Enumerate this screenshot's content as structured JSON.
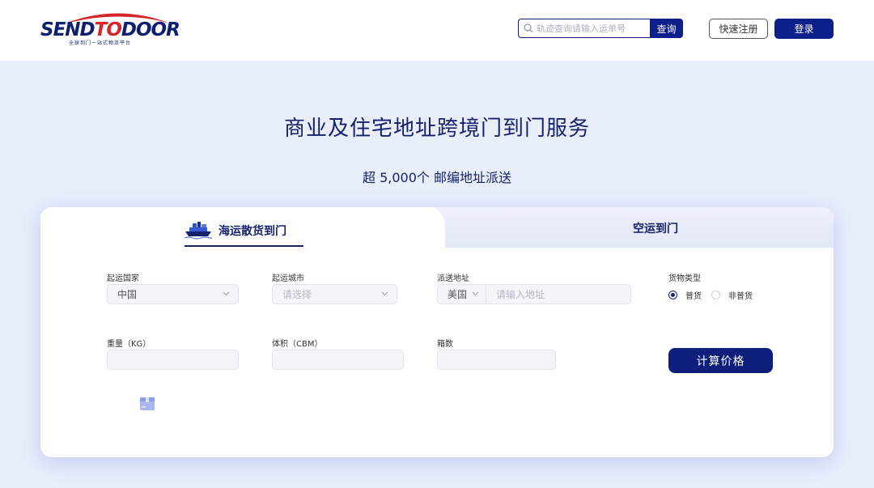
{
  "header": {
    "logo": {
      "text_a": "SEND",
      "text_b": "TO",
      "text_c": "DOOR",
      "tagline": "全球到门一站式物流平台"
    },
    "search": {
      "placeholder": "轨迹查询请输入运单号",
      "button_label": "查询"
    },
    "register_label": "快速注册",
    "login_label": "登录"
  },
  "hero": {
    "title": "商业及住宅地址跨境门到门服务",
    "subtitle": "超 5,000个 邮编地址派送"
  },
  "tabs": [
    {
      "label": "海运散货到门",
      "icon": "cargo-ship-icon",
      "active": true
    },
    {
      "label": "空运到门",
      "active": false
    }
  ],
  "form": {
    "origin_country": {
      "label": "起运国家",
      "value": "中国"
    },
    "origin_city": {
      "label": "起运城市",
      "placeholder": "请选择"
    },
    "destination": {
      "label": "派送地址",
      "country": "美国",
      "placeholder": "请输入地址"
    },
    "cargo_type": {
      "label": "货物类型",
      "options": [
        "普货",
        "非普货"
      ],
      "selected": "普货"
    },
    "weight": {
      "label": "重量（KG）",
      "value": ""
    },
    "volume": {
      "label": "体积（CBM）",
      "value": ""
    },
    "boxes": {
      "label": "箱数",
      "value": ""
    },
    "calculate_label": "计算价格"
  },
  "colors": {
    "brand_navy": "#0d1f8a",
    "brand_red": "#d7262b",
    "page_bg": "#e9eefb"
  }
}
